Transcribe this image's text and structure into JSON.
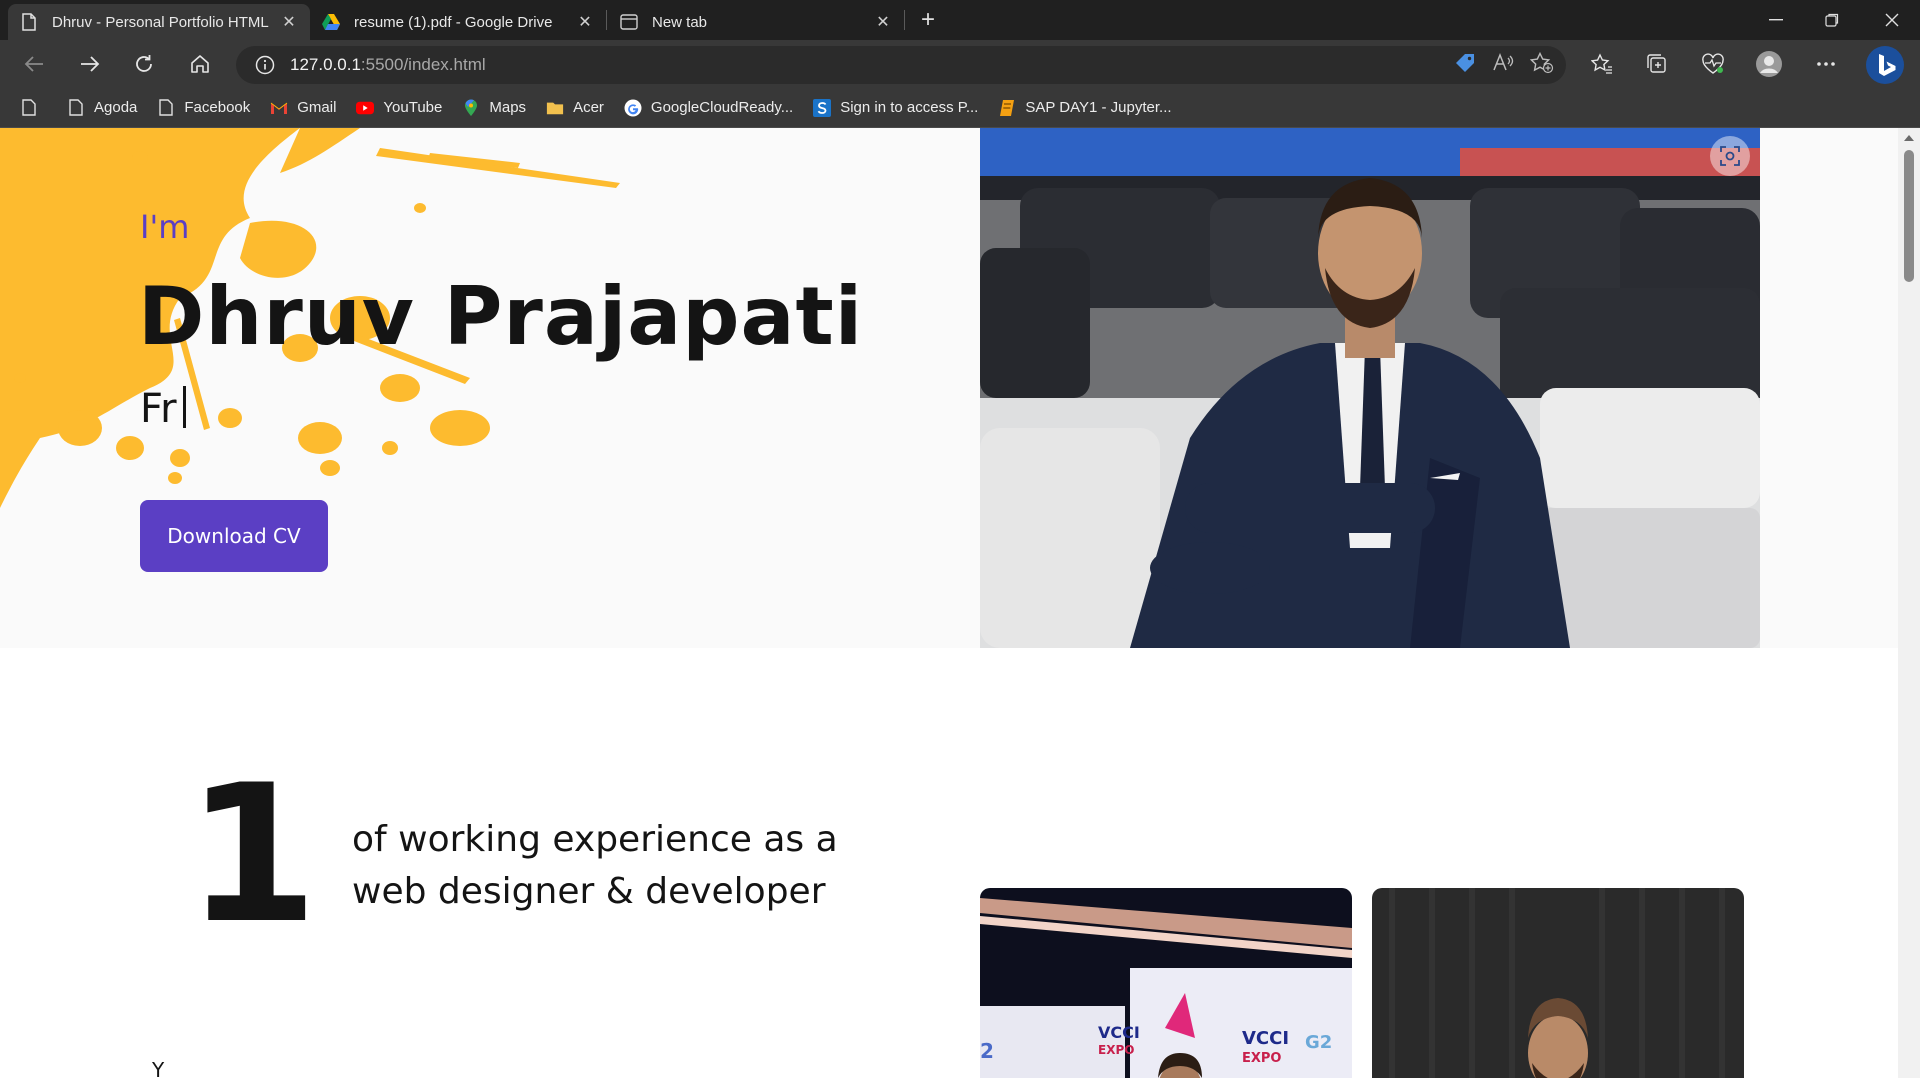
{
  "browser": {
    "tabs": [
      {
        "title": "Dhruv - Personal Portfolio HTML",
        "icon": "page-icon",
        "active": true
      },
      {
        "title": "resume (1).pdf - Google Drive",
        "icon": "google-drive-icon",
        "active": false
      },
      {
        "title": "New tab",
        "icon": "new-tab-icon",
        "active": false
      }
    ],
    "address": {
      "host": "127.0.0.1",
      "path": ":5500/index.html"
    },
    "bookmarks": [
      {
        "label": "",
        "icon": "page-icon"
      },
      {
        "label": "Agoda",
        "icon": "page-icon"
      },
      {
        "label": "Facebook",
        "icon": "page-icon"
      },
      {
        "label": "Gmail",
        "icon": "gmail-icon"
      },
      {
        "label": "YouTube",
        "icon": "youtube-icon"
      },
      {
        "label": "Maps",
        "icon": "maps-icon"
      },
      {
        "label": "Acer",
        "icon": "folder-icon"
      },
      {
        "label": "GoogleCloudReady...",
        "icon": "google-icon"
      },
      {
        "label": "Sign in to access P...",
        "icon": "s-icon"
      },
      {
        "label": "SAP DAY1 - Jupyter...",
        "icon": "notebook-icon"
      }
    ]
  },
  "hero": {
    "intro": "I'm",
    "name": "Dhruv Prajapati",
    "typed_text": "Fr",
    "download_button": "Download CV"
  },
  "experience": {
    "number": "1",
    "description": "of working experience as a web designer & developer",
    "unit_partial": "Y"
  },
  "colors": {
    "accent": "#5b3fc4",
    "splash": "#fdbb2f",
    "chrome_dark": "#202020",
    "chrome_toolbar": "#383838"
  }
}
